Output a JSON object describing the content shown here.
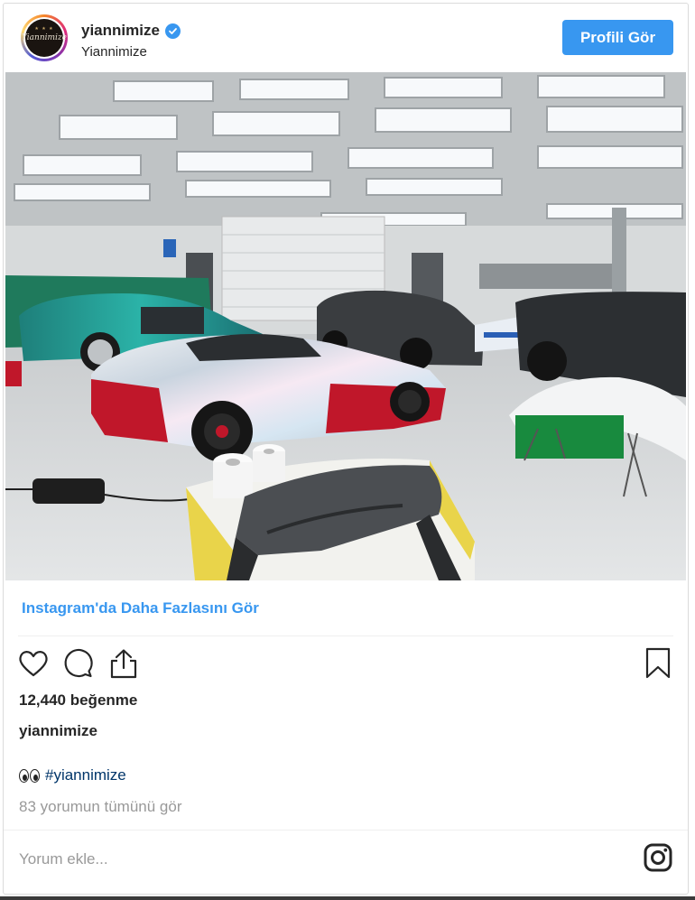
{
  "header": {
    "username": "yiannimize",
    "display_name": "Yiannimize",
    "avatar_text": "Yiannimize",
    "avatar_stars": "★ ★ ★",
    "profile_button_label": "Profili Gör",
    "verified_icon": "verified-badge-icon"
  },
  "post": {
    "image_icon": "photo-garage-cars",
    "more_link": "Instagram'da Daha Fazlasını Gör",
    "actions": {
      "like_icon": "heart-icon",
      "comment_icon": "comment-icon",
      "share_icon": "share-icon",
      "save_icon": "bookmark-icon"
    },
    "likes": "12,440 beğenme",
    "caption_user": "yiannimize",
    "caption_emoji": "👀",
    "hashtag": "#yiannimize",
    "view_comments": "83 yorumun tümünü gör",
    "comment_placeholder": "Yorum ekle...",
    "instagram_icon": "instagram-logo-icon"
  },
  "colors": {
    "accent": "#3897f0",
    "hashtag": "#003569",
    "muted": "#999999",
    "text": "#262626"
  }
}
